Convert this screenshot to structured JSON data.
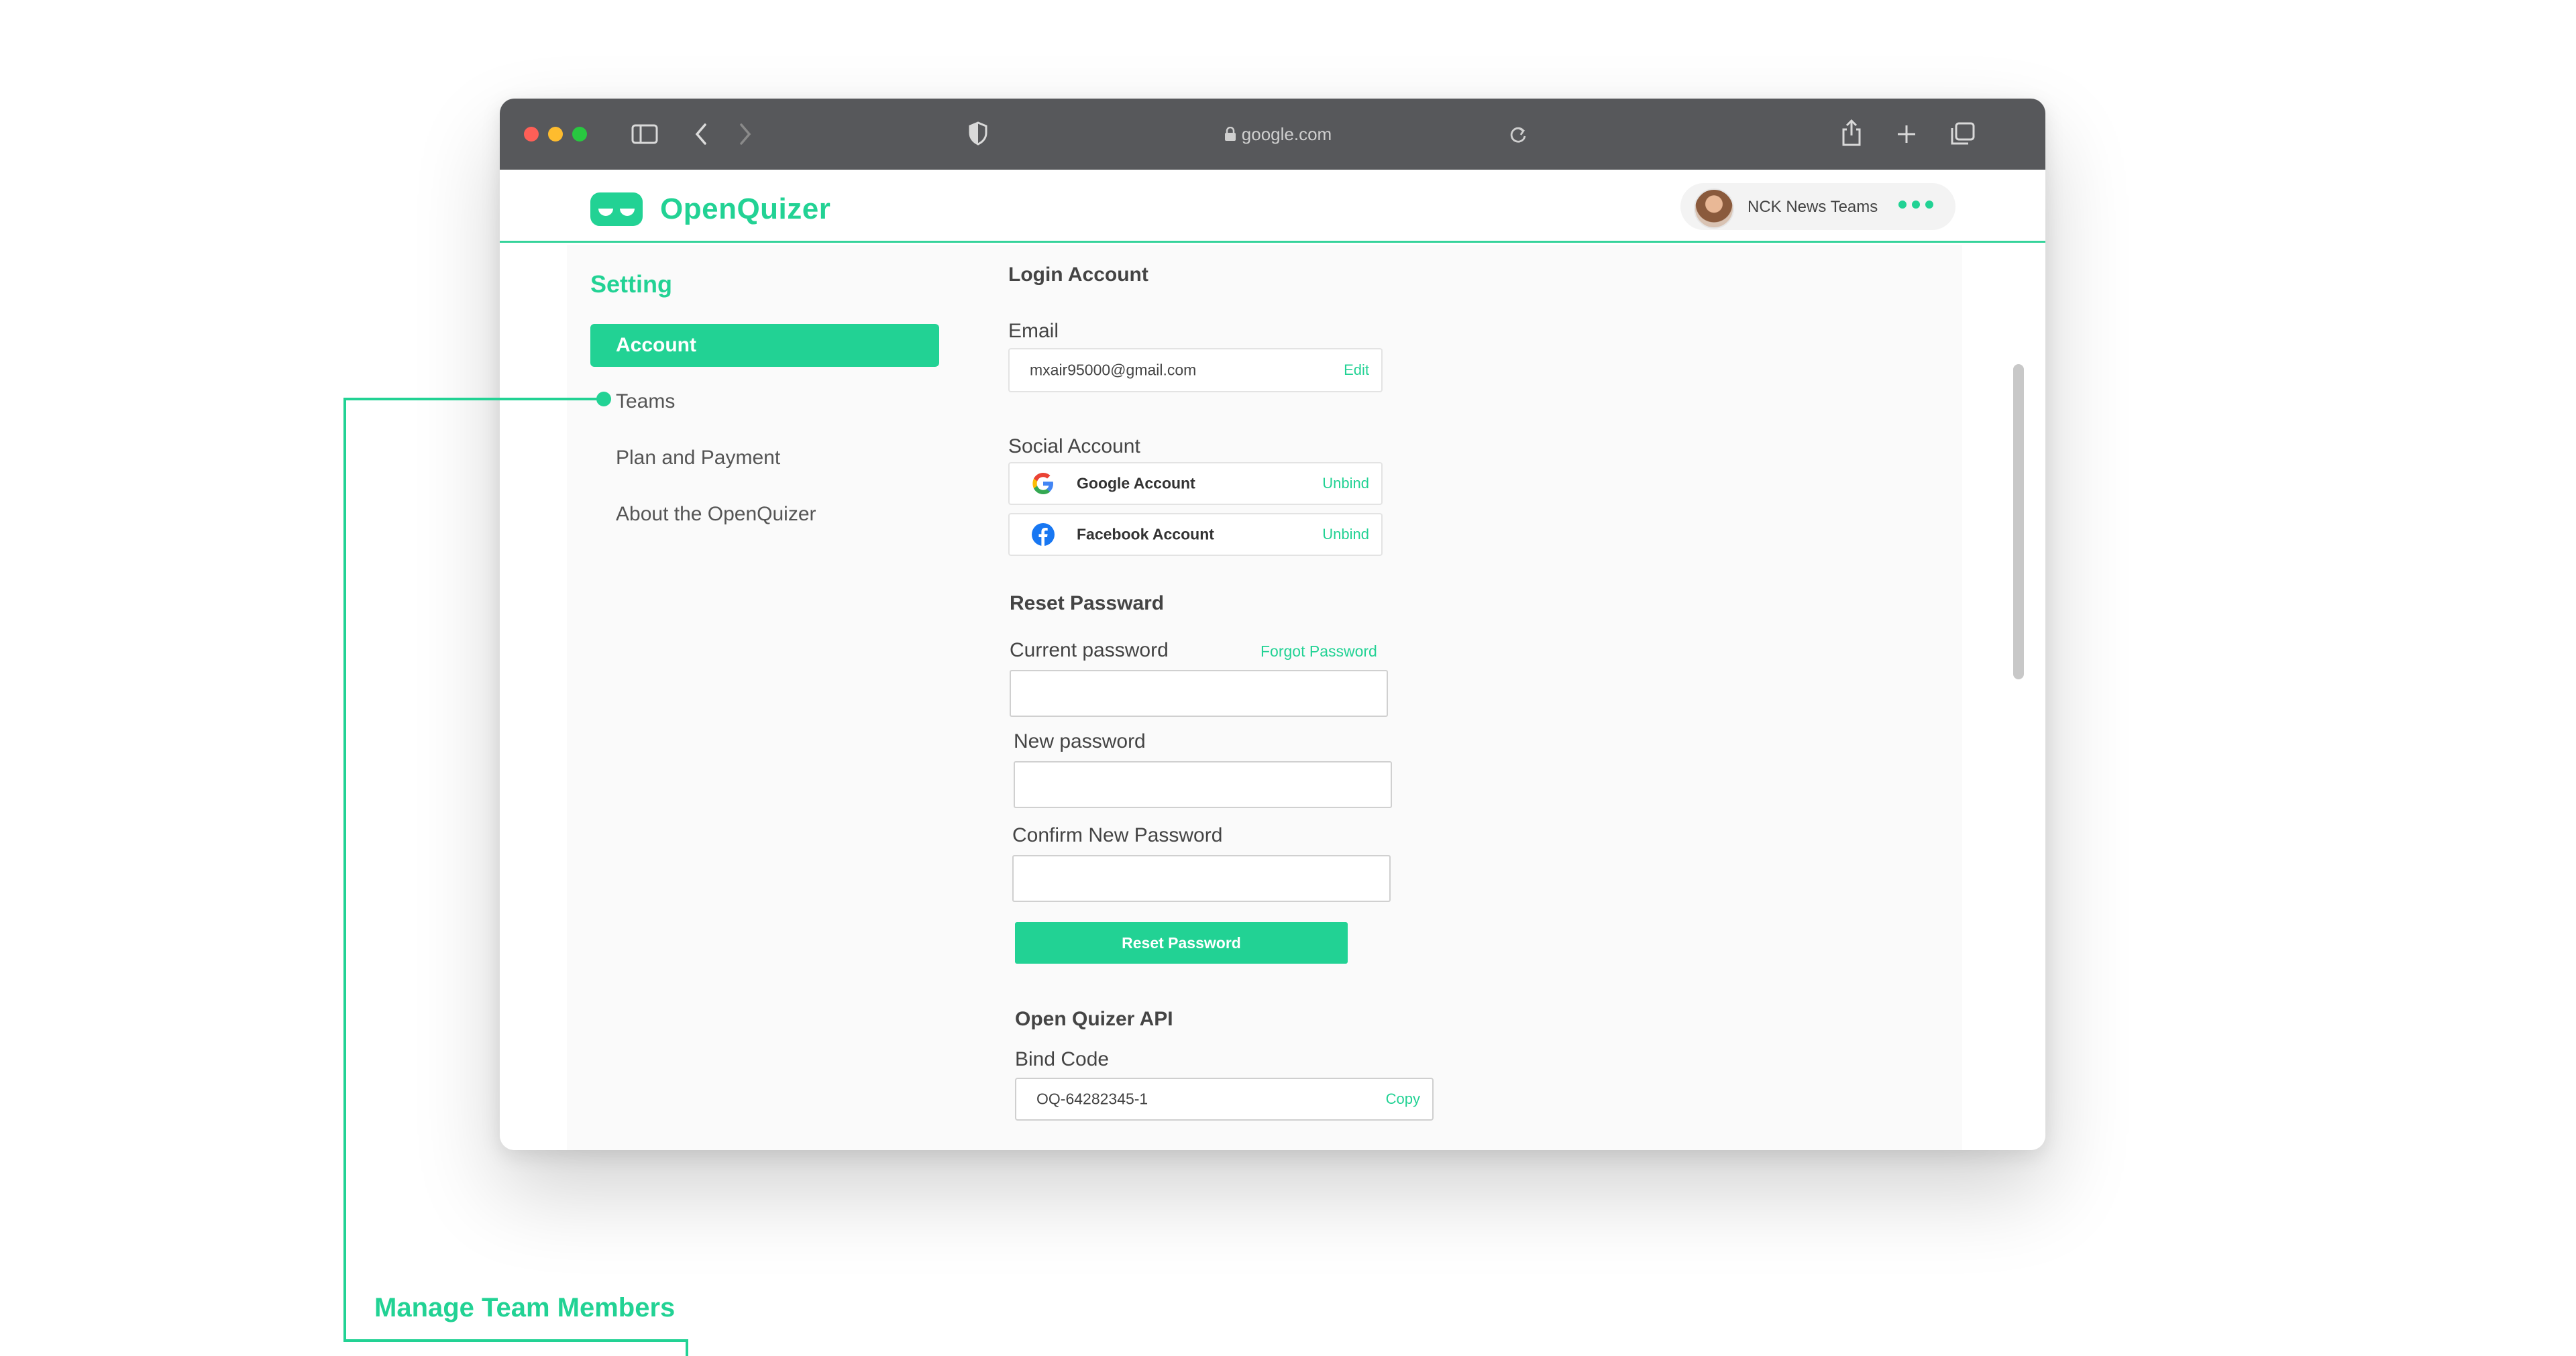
{
  "browser": {
    "url": "google.com"
  },
  "app": {
    "logo_text": "OpenQuizer",
    "team_name": "NCK News Teams",
    "accent": "#22d294"
  },
  "sidebar": {
    "title": "Setting",
    "items": [
      {
        "label": "Account",
        "active": true
      },
      {
        "label": "Teams",
        "active": false
      },
      {
        "label": "Plan and Payment",
        "active": false
      },
      {
        "label": "About the OpenQuizer",
        "active": false
      }
    ]
  },
  "account": {
    "login_title": "Login Account",
    "email_label": "Email",
    "email_value": "mxair95000@gmail.com",
    "email_action": "Edit",
    "social_title": "Social Account",
    "social": [
      {
        "name": "Google Account",
        "action": "Unbind",
        "icon": "google-icon"
      },
      {
        "name": "Facebook Account",
        "action": "Unbind",
        "icon": "facebook-icon"
      }
    ],
    "reset_title": "Reset Passward",
    "current_password_label": "Current password",
    "forgot_password": "Forgot Password",
    "new_password_label": "New password",
    "confirm_password_label": "Confirm New Password",
    "reset_button": "Reset Password",
    "api_title": "Open Quizer API",
    "bind_code_label": "Bind Code",
    "bind_code_value": "OQ-64282345-1",
    "bind_code_action": "Copy"
  },
  "annotation": {
    "text": "Manage Team Members"
  }
}
